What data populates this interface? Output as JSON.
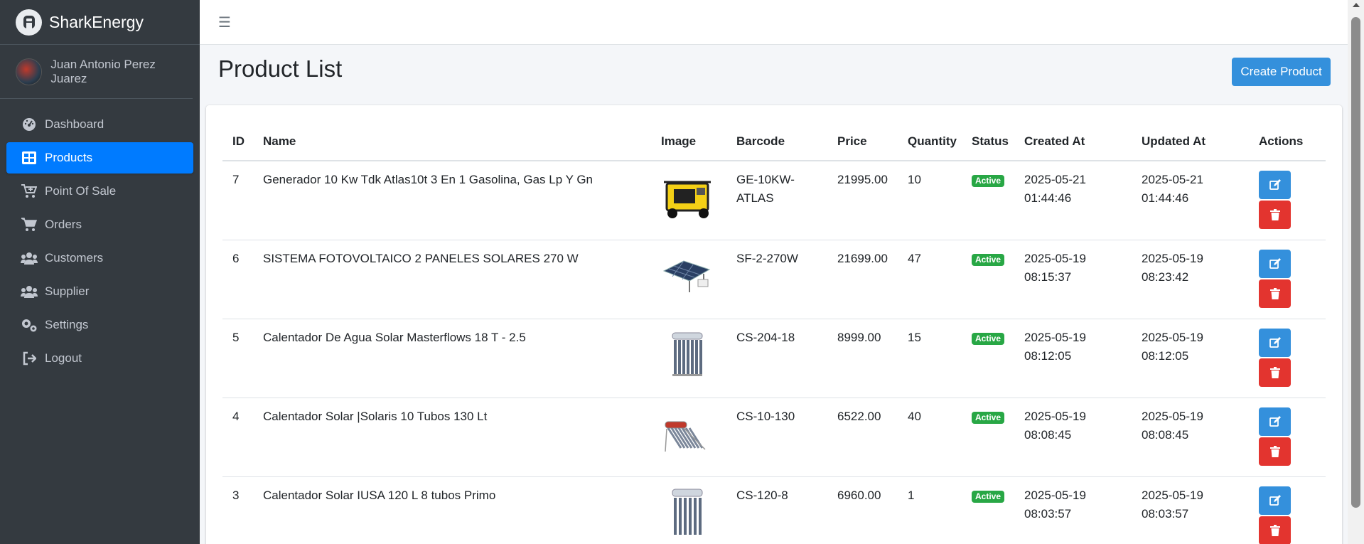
{
  "brand": {
    "name": "SharkEnergy"
  },
  "user": {
    "name": "Juan Antonio Perez Juarez"
  },
  "sidebar": {
    "items": [
      {
        "label": "Dashboard",
        "icon": "dashboard-icon"
      },
      {
        "label": "Products",
        "icon": "grid-icon",
        "active": true
      },
      {
        "label": "Point Of Sale",
        "icon": "cart-plus-icon"
      },
      {
        "label": "Orders",
        "icon": "cart-icon"
      },
      {
        "label": "Customers",
        "icon": "users-icon"
      },
      {
        "label": "Supplier",
        "icon": "users-icon"
      },
      {
        "label": "Settings",
        "icon": "gears-icon"
      },
      {
        "label": "Logout",
        "icon": "sign-out-icon"
      }
    ]
  },
  "header": {
    "title": "Product List",
    "create_label": "Create Product"
  },
  "table": {
    "columns": [
      "ID",
      "Name",
      "Image",
      "Barcode",
      "Price",
      "Quantity",
      "Status",
      "Created At",
      "Updated At",
      "Actions"
    ],
    "rows": [
      {
        "id": "7",
        "name": "Generador 10 Kw Tdk Atlas10t 3 En 1 Gasolina, Gas Lp Y Gn",
        "image": "generator-image",
        "barcode": "GE-10KW-ATLAS",
        "price": "21995.00",
        "quantity": "10",
        "status": "Active",
        "created_date": "2025-05-21",
        "created_time": "01:44:46",
        "updated_date": "2025-05-21",
        "updated_time": "01:44:46"
      },
      {
        "id": "6",
        "name": "SISTEMA FOTOVOLTAICO 2 PANELES SOLARES 270 W",
        "image": "solar-panel-image",
        "barcode": "SF-2-270W",
        "price": "21699.00",
        "quantity": "47",
        "status": "Active",
        "created_date": "2025-05-19",
        "created_time": "08:15:37",
        "updated_date": "2025-05-19",
        "updated_time": "08:23:42"
      },
      {
        "id": "5",
        "name": "Calentador De Agua Solar Masterflows 18 T - 2.5",
        "image": "water-heater-image",
        "barcode": "CS-204-18",
        "price": "8999.00",
        "quantity": "15",
        "status": "Active",
        "created_date": "2025-05-19",
        "created_time": "08:12:05",
        "updated_date": "2025-05-19",
        "updated_time": "08:12:05"
      },
      {
        "id": "4",
        "name": "Calentador Solar |Solaris 10 Tubos 130 Lt",
        "image": "solar-heater-image",
        "barcode": "CS-10-130",
        "price": "6522.00",
        "quantity": "40",
        "status": "Active",
        "created_date": "2025-05-19",
        "created_time": "08:08:45",
        "updated_date": "2025-05-19",
        "updated_time": "08:08:45"
      },
      {
        "id": "3",
        "name": "Calentador Solar IUSA 120 L 8 tubos Primo",
        "image": "water-heater-image",
        "barcode": "CS-120-8",
        "price": "6960.00",
        "quantity": "1",
        "status": "Active",
        "created_date": "2025-05-19",
        "created_time": "08:03:57",
        "updated_date": "2025-05-19",
        "updated_time": "08:03:57"
      }
    ]
  },
  "colors": {
    "sidebar_bg": "#343a40",
    "active": "#007bff",
    "primary": "#3490dc",
    "danger": "#e3342f",
    "success": "#28a745"
  }
}
